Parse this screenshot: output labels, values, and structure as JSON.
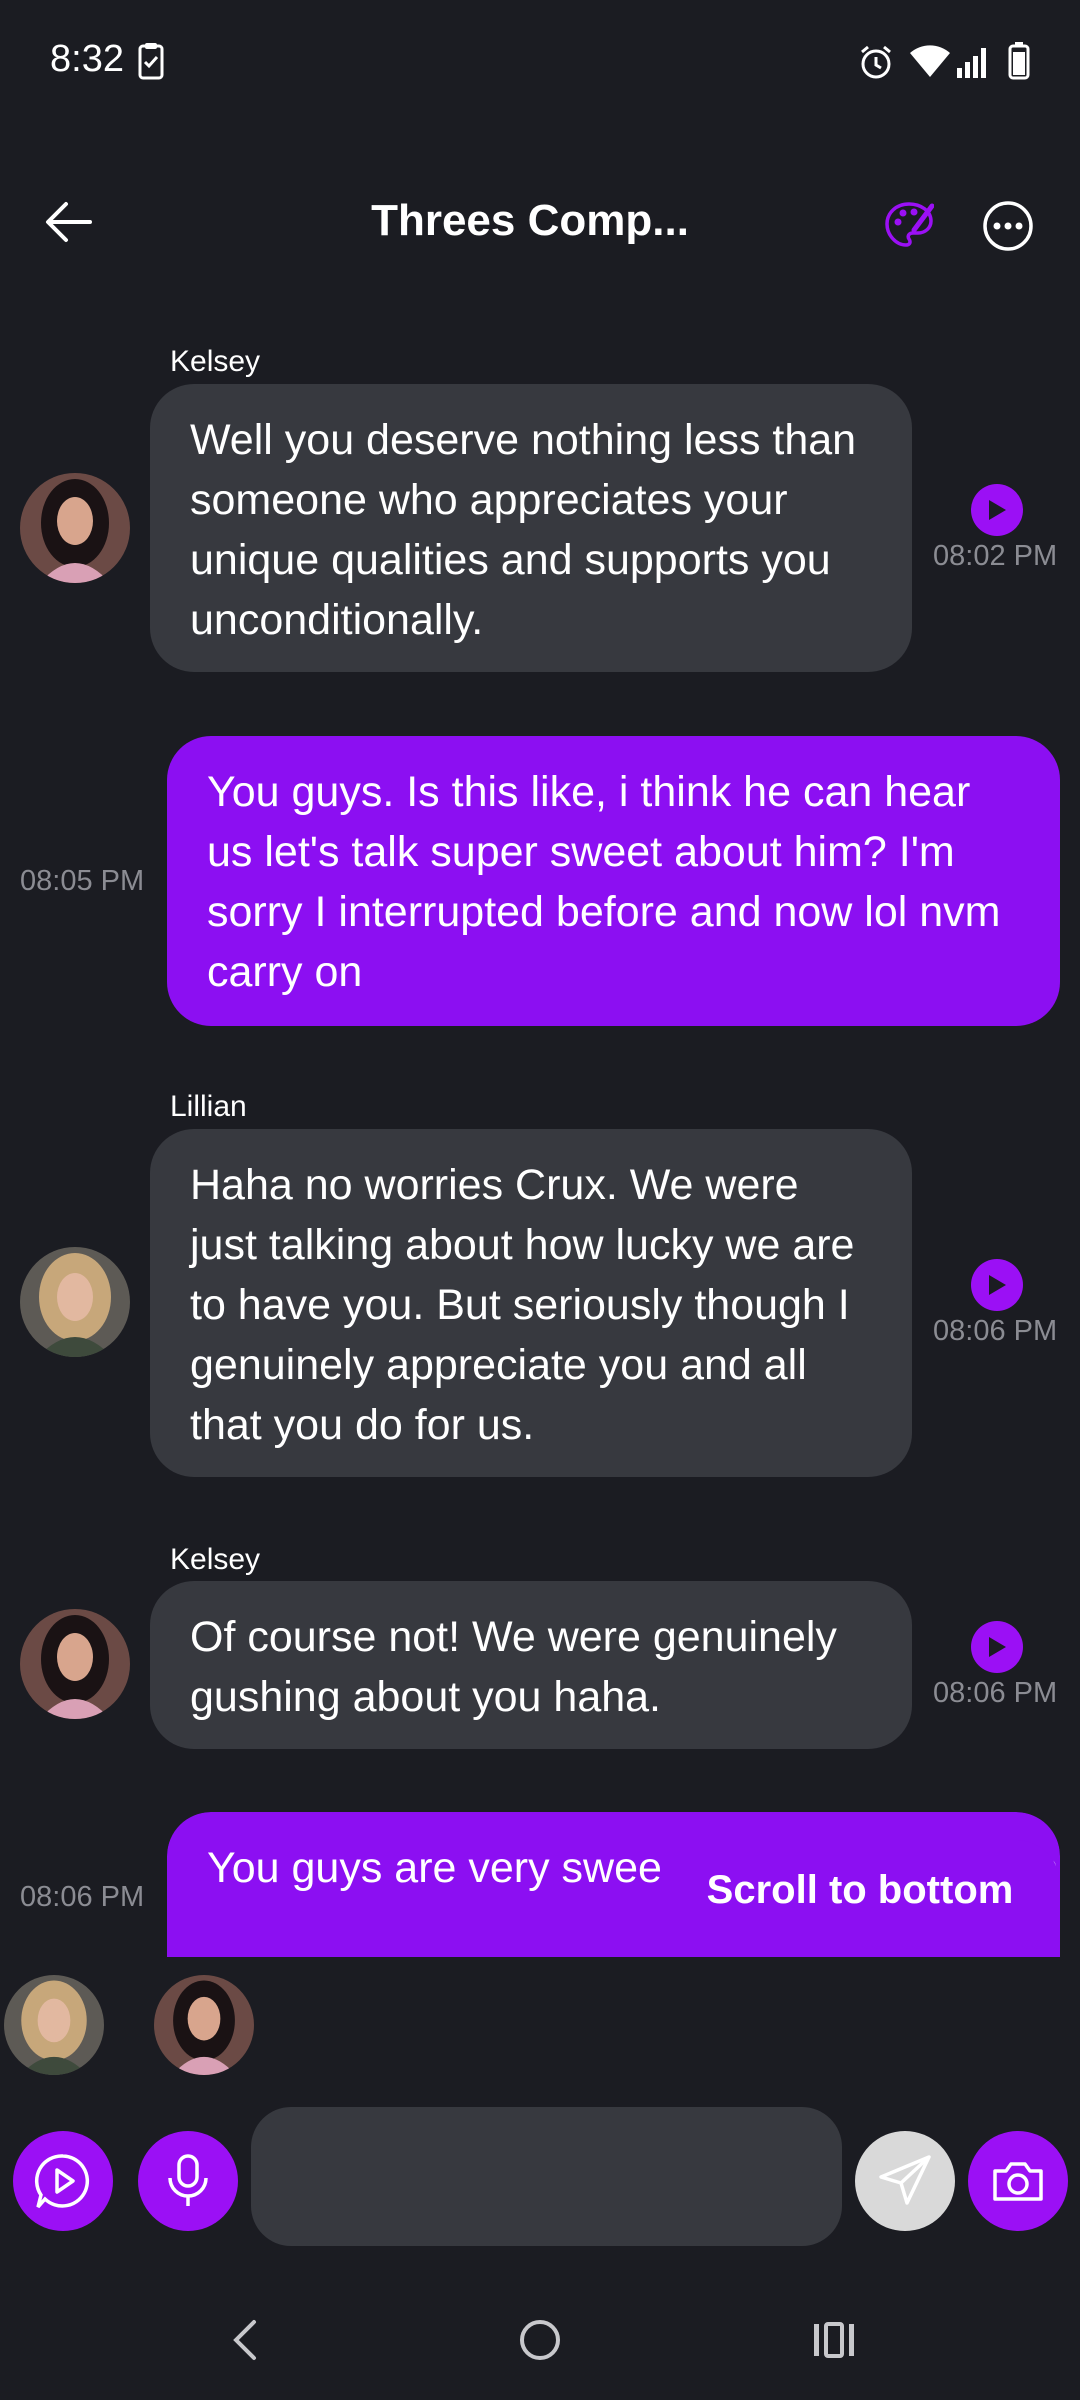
{
  "status_bar": {
    "time": "8:32"
  },
  "header": {
    "title": "Threes Comp..."
  },
  "messages": [
    {
      "sender": "Kelsey",
      "text": "Well you deserve nothing less than someone who appreciates your unique qualities and supports you unconditionally.",
      "time": "08:02 PM"
    },
    {
      "text": "You guys. Is this like, i think he can hear us let's talk super sweet about him? I'm sorry I interrupted before and now lol nvm carry on",
      "time": "08:05 PM"
    },
    {
      "sender": "Lillian",
      "text": "Haha no worries Crux. We were just talking about how lucky we are to have you. But seriously though I genuinely appreciate you and all that you do for us.",
      "time": "08:06 PM"
    },
    {
      "sender": "Kelsey",
      "text": "Of course not! We were genuinely gushing about you haha.",
      "time": "08:06 PM"
    },
    {
      "text": "You guys are very swee’ ... one. I'm very happy",
      "time": "08:06 PM"
    }
  ],
  "scroll_to_bottom_label": "Scroll to bottom",
  "composer": {
    "placeholder": ""
  },
  "colors": {
    "accent": "#8c0ff2",
    "bubble_theirs": "#37393f",
    "background": "#1b1c22"
  }
}
